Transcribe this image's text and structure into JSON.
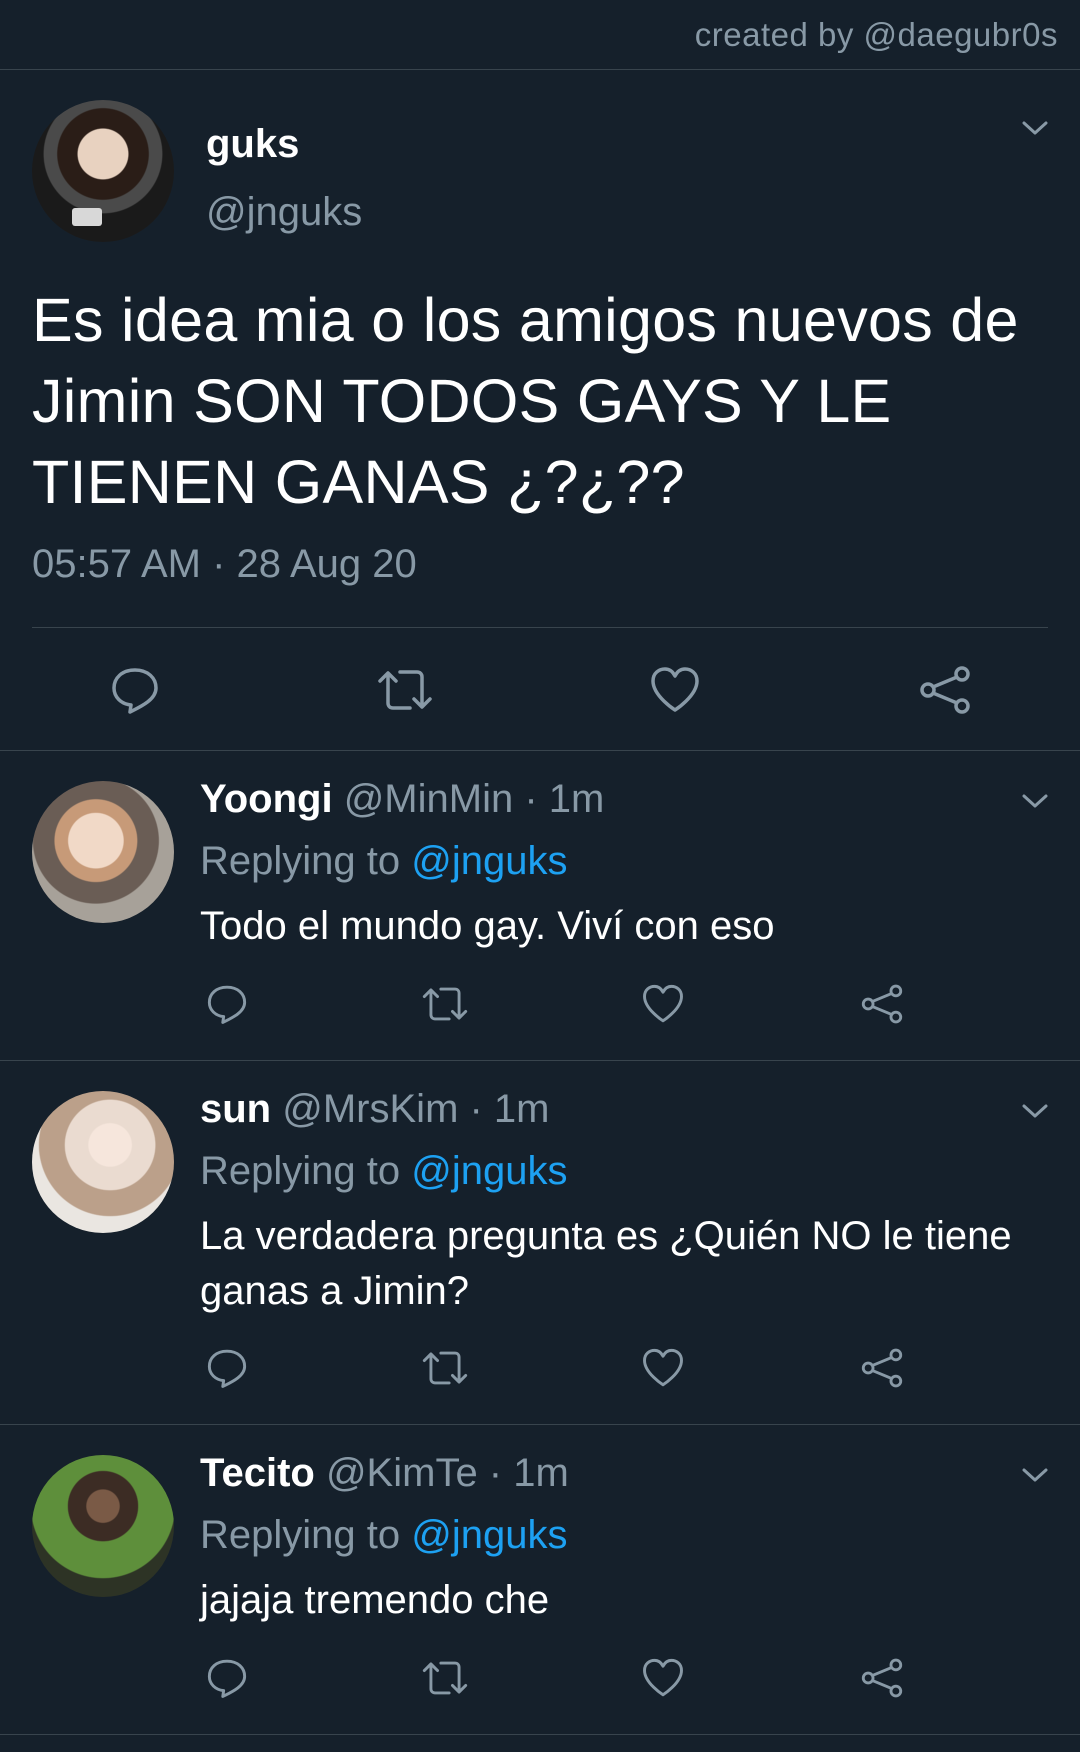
{
  "credit": "created by @daegubr0s",
  "main_tweet": {
    "name": "guks",
    "handle": "@jnguks",
    "text": "Es idea mia o los amigos nuevos de Jimin SON TODOS GAYS Y LE TIENEN GANAS ¿?¿??",
    "timestamp": "05:57 AM · 28 Aug 20"
  },
  "replies": [
    {
      "name": "Yoongi",
      "meta": "@MinMin · 1m",
      "replying_prefix": "Replying to ",
      "replying_handle": "@jnguks",
      "text": "Todo el mundo gay. Viví con eso"
    },
    {
      "name": "sun",
      "meta": "@MrsKim · 1m",
      "replying_prefix": "Replying to ",
      "replying_handle": "@jnguks",
      "text": "La verdadera pregunta es ¿Quién NO le tiene ganas a Jimin?"
    },
    {
      "name": "Tecito",
      "meta": "@KimTe · 1m",
      "replying_prefix": "Replying to ",
      "replying_handle": "@jnguks",
      "text": "jajaja tremendo che"
    }
  ],
  "icons": [
    "reply-icon",
    "retweet-icon",
    "like-icon",
    "share-icon",
    "chevron-down-icon"
  ],
  "colors": {
    "background": "#15202b",
    "divider": "#38444d",
    "secondary_text": "#8899a6",
    "link": "#1da1f2"
  }
}
